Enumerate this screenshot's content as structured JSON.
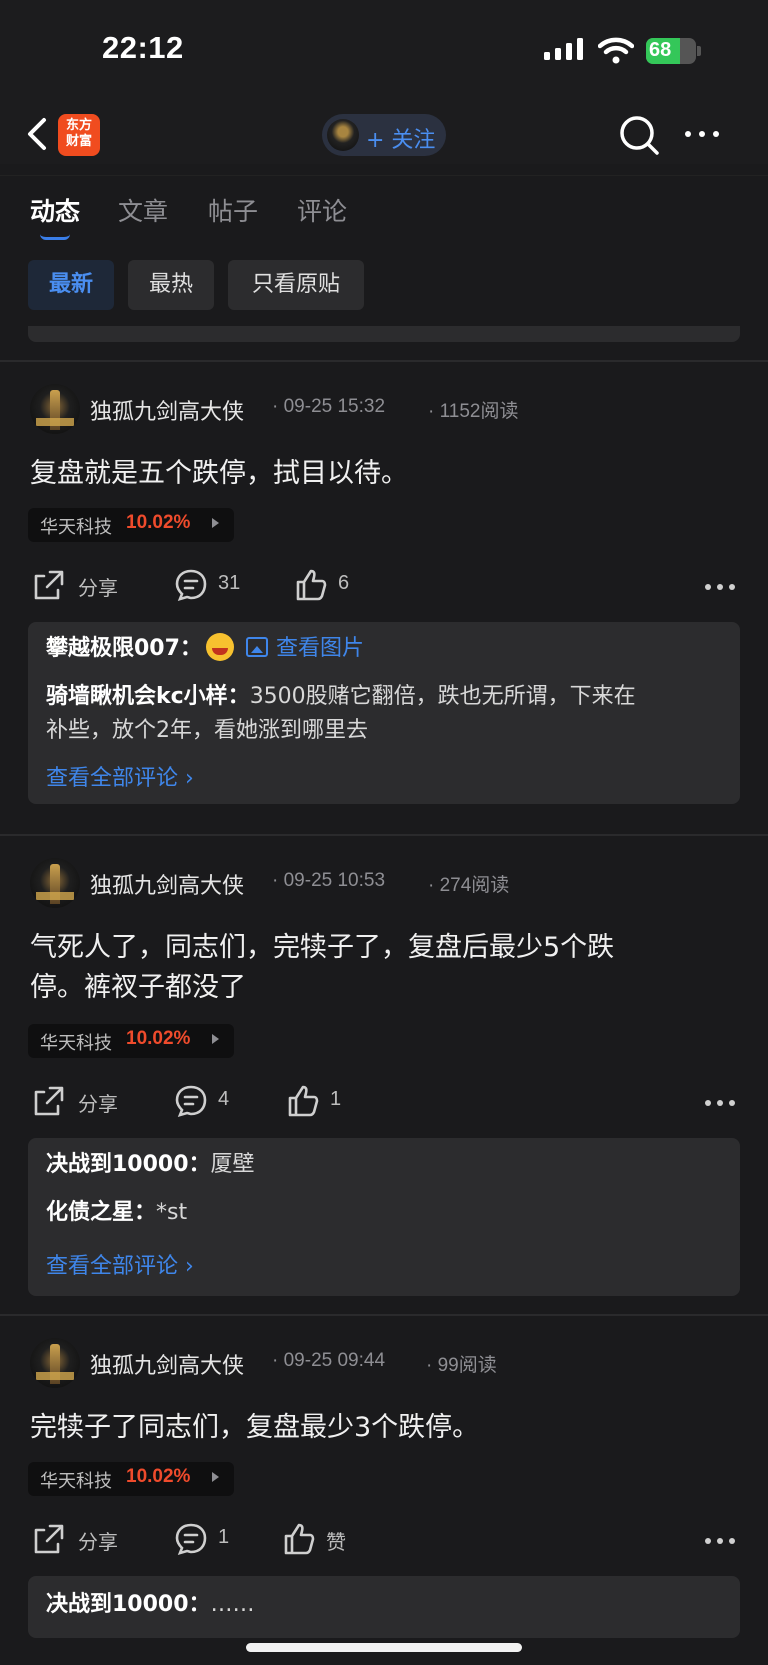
{
  "status_bar": {
    "time": "22:12",
    "battery": "68",
    "battery_level": 0.68
  },
  "nav": {
    "logo_line1": "东方",
    "logo_line2": "财富",
    "follow_label": "+ 关注"
  },
  "tabs": [
    {
      "label": "动态",
      "active": true
    },
    {
      "label": "文章",
      "active": false
    },
    {
      "label": "帖子",
      "active": false
    },
    {
      "label": "评论",
      "active": false
    }
  ],
  "filters": [
    {
      "label": "最新",
      "active": true
    },
    {
      "label": "最热",
      "active": false
    },
    {
      "label": "只看原贴",
      "active": false
    }
  ],
  "posts": [
    {
      "author": "独孤九剑高大侠",
      "time": "09-25 15:32",
      "reads": "1152阅读",
      "content_lines": [
        "复盘就是五个跌停，拭目以待。"
      ],
      "stock_name": "华天科技",
      "stock_change": "10.02%",
      "share_label": "分享",
      "comment_count": "31",
      "like_count": "6",
      "comments": [
        {
          "user": "攀越极限007：",
          "text": "",
          "has_emoji": true,
          "image_link": "查看图片"
        },
        {
          "user": "骑墙瞅机会kc小样：",
          "text": "3500股赌它翻倍，跌也无所谓，下来在",
          "text2": "补些，放个2年，看她涨到哪里去"
        }
      ],
      "view_all": "查看全部评论"
    },
    {
      "author": "独孤九剑高大侠",
      "time": "09-25 10:53",
      "reads": "274阅读",
      "content_lines": [
        "气死人了，同志们，完犊子了，复盘后最少5个跌",
        "停。裤衩子都没了"
      ],
      "stock_name": "华天科技",
      "stock_change": "10.02%",
      "share_label": "分享",
      "comment_count": "4",
      "like_count": "1",
      "comments": [
        {
          "user": "决战到10000：",
          "text": "厦壁"
        },
        {
          "user": "化债之星：",
          "text": "*st"
        }
      ],
      "view_all": "查看全部评论"
    },
    {
      "author": "独孤九剑高大侠",
      "time": "09-25 09:44",
      "reads": "99阅读",
      "content_lines": [
        "完犊子了同志们，复盘最少3个跌停。"
      ],
      "stock_name": "华天科技",
      "stock_change": "10.02%",
      "share_label": "分享",
      "comment_count": "1",
      "like_count": "赞",
      "comments": [
        {
          "user": "决战到10000：",
          "text": "……"
        }
      ]
    }
  ],
  "colors": {
    "accent": "#3f86ea",
    "stock_up": "#ef4b2c",
    "background": "#1a1a1c",
    "card": "#2c2c2e"
  }
}
